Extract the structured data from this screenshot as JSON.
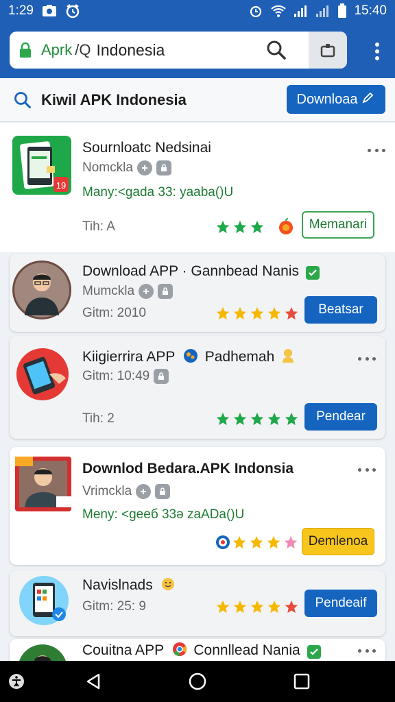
{
  "status_bar": {
    "time": "1:29",
    "clock": "15:40",
    "colors": {
      "background": "#1f5fb5"
    }
  },
  "browser": {
    "url_prefix": "Aprk",
    "url_separator": "/Q",
    "url_query": "Indonesia"
  },
  "search_header": {
    "title": "Kiwil APK Indonesia",
    "download_label": "Downloaa"
  },
  "apps": [
    {
      "title": "Sournloatc Nedsinai",
      "subtitle": "Nomckla",
      "meta": "Many:<gada 33:  yaaba()U",
      "info": "Tih: A",
      "stars": 3,
      "button": "Memanari"
    },
    {
      "title": "Download APP · Gannbead Nanis",
      "subtitle": "Mumckla",
      "info": "Gitm: 2010",
      "stars": 5,
      "button": "Beatsar"
    },
    {
      "title": "Kiigierrira APP",
      "title_suffix": "Padhemah",
      "info_top": "Gitm: 10:49",
      "info": "Tih: 2",
      "stars": 5,
      "button": "Pendear"
    },
    {
      "title": "Downlod Bedara.APK Indonsia",
      "subtitle": "Vrimckla",
      "meta": "Meny: <geeб 33ə zaADa()U",
      "stars": 4,
      "button": "Demlenoa"
    },
    {
      "title": "Navislnads",
      "info": "Gitm: 25: 9",
      "stars": 5,
      "button": "Pendeaif"
    },
    {
      "title": "Couitna APP",
      "title_suffix": "Connllead Nania"
    }
  ],
  "icons": {
    "status_left": [
      "photo-icon",
      "alarm-icon"
    ],
    "status_right": [
      "alarm-clock-icon",
      "wifi-icon",
      "signal-icon",
      "battery-icon"
    ],
    "nav": [
      "accessibility-icon",
      "back-icon",
      "home-icon",
      "recents-icon"
    ]
  },
  "colors": {
    "primary": "#1565c0",
    "green": "#2ca84a",
    "star": "#f5b800",
    "star_red": "#e74c3c"
  }
}
